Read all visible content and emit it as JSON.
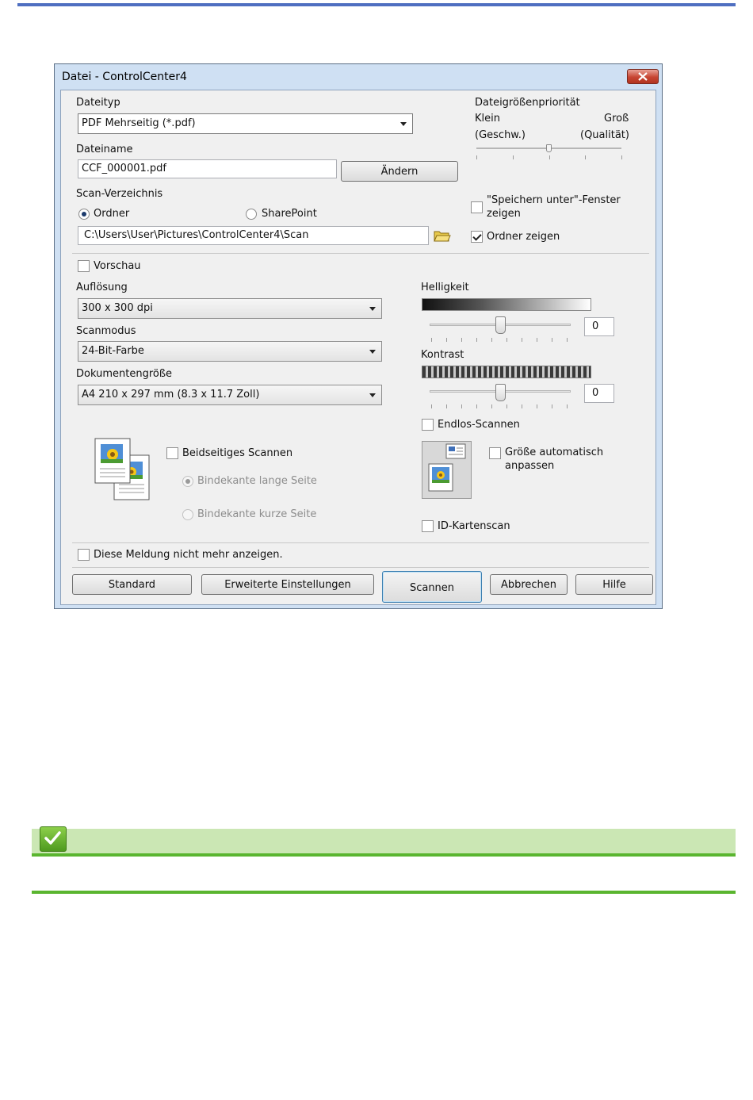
{
  "window": {
    "title": "Datei - ControlCenter4"
  },
  "file_type": {
    "label": "Dateityp",
    "value": "PDF Mehrseitig (*.pdf)"
  },
  "file_name": {
    "label": "Dateiname",
    "value": "CCF_000001.pdf",
    "change_button": "Ändern"
  },
  "file_size_priority": {
    "label": "Dateigrößenpriorität",
    "small": "Klein",
    "small_sub": "(Geschw.)",
    "large": "Groß",
    "large_sub": "(Qualität)"
  },
  "scan_location": {
    "label": "Scan-Verzeichnis",
    "option_folder": "Ordner",
    "option_sharepoint": "SharePoint",
    "selected": "Ordner",
    "path": "C:\\Users\\User\\Pictures\\ControlCenter4\\Scan"
  },
  "save_as_window": {
    "label_line1": "\"Speichern unter\"-Fenster",
    "label_line2": "zeigen",
    "checked": false
  },
  "show_folder": {
    "label": "Ordner zeigen",
    "checked": true
  },
  "preview": {
    "label": "Vorschau",
    "checked": false
  },
  "resolution": {
    "label": "Auflösung",
    "value": "300 x 300 dpi"
  },
  "scan_mode": {
    "label": "Scanmodus",
    "value": "24-Bit-Farbe"
  },
  "document_size": {
    "label": "Dokumentengröße",
    "value": "A4 210 x 297 mm (8.3 x 11.7 Zoll)"
  },
  "brightness": {
    "label": "Helligkeit",
    "value": "0"
  },
  "contrast": {
    "label": "Kontrast",
    "value": "0"
  },
  "continuous_scan": {
    "label": "Endlos-Scannen",
    "checked": false
  },
  "duplex": {
    "label": "Beidseitiges Scannen",
    "checked": false,
    "option_long": "Bindekante lange Seite",
    "option_short": "Bindekante kurze Seite"
  },
  "auto_size": {
    "label_line1": "Größe automatisch",
    "label_line2": "anpassen",
    "checked": false
  },
  "id_card_scan": {
    "label": "ID-Kartenscan",
    "checked": false
  },
  "dont_show": {
    "label": "Diese Meldung nicht mehr anzeigen.",
    "checked": false
  },
  "buttons": {
    "standard": "Standard",
    "advanced": "Erweiterte Einstellungen",
    "scan": "Scannen",
    "cancel": "Abbrechen",
    "help": "Hilfe"
  },
  "colors": {
    "title_bar": "#cfe0f3",
    "close_button": "#c74532",
    "note_bar": "#cbe7b4",
    "note_line": "#5ab52f",
    "top_rule": "#4f6fc1"
  }
}
